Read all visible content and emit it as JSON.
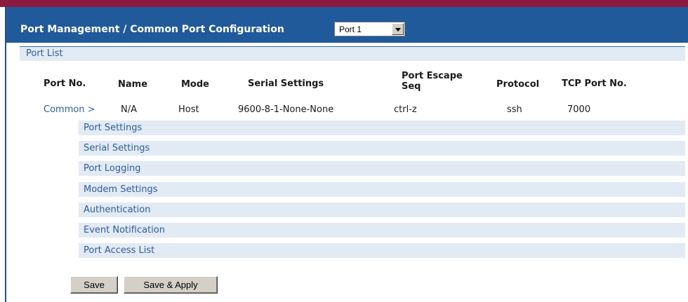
{
  "header": {
    "title": "Port Management / Common Port Configuration",
    "port_select": {
      "selected": "Port 1"
    }
  },
  "section": {
    "title": "Port List"
  },
  "table": {
    "columns": [
      "Port No.",
      "Name",
      "Mode",
      "Serial Settings",
      "Port Escape Seq",
      "Protocol",
      "TCP Port No."
    ],
    "row": {
      "port_no": "Common >",
      "name": "N/A",
      "mode": "Host",
      "serial_settings": "9600-8-1-None-None",
      "escape_seq": "ctrl-z",
      "protocol": "ssh",
      "tcp_port": "7000"
    }
  },
  "sub_items": [
    "Port Settings",
    "Serial Settings",
    "Port Logging",
    "Modem Settings",
    "Authentication",
    "Event Notification",
    "Port Access List"
  ],
  "buttons": {
    "save": "Save",
    "save_apply": "Save & Apply"
  },
  "colors": {
    "top_bar": "#8a1b3f",
    "header": "#215a9a",
    "row_bg": "#e2eaf4",
    "link": "#2d5d9b"
  }
}
